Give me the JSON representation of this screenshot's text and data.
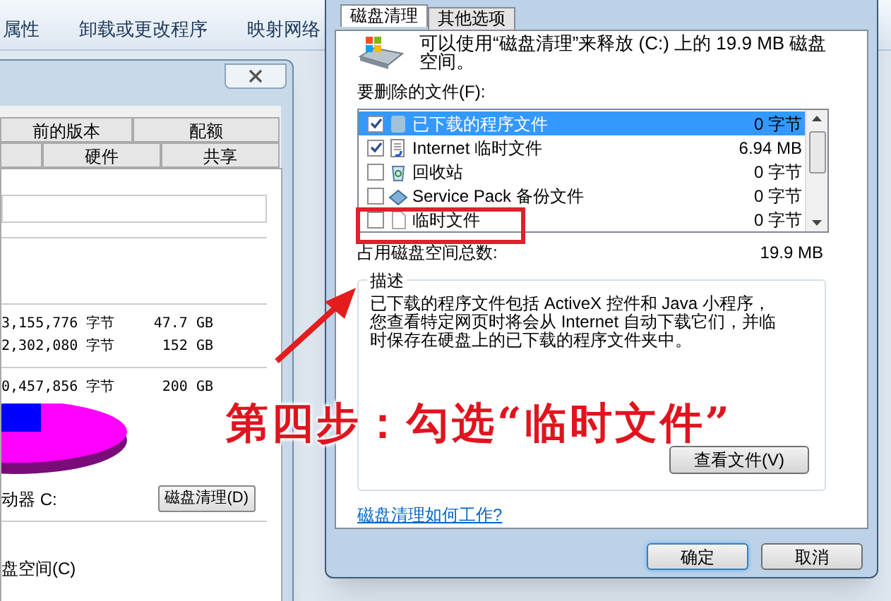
{
  "explorer_toolbar": {
    "items": [
      "属性",
      "卸载或更改程序",
      "映射网络"
    ]
  },
  "properties_dialog": {
    "tabs_row1": [
      "前的版本",
      "配额"
    ],
    "tabs_row2": [
      "硬件",
      "共享"
    ],
    "rows": [
      {
        "bytes": "3,155,776 字节",
        "size": "47.7 GB"
      },
      {
        "bytes": "2,302,080 字节",
        "size": "152 GB"
      },
      {
        "bytes": "0,457,856 字节",
        "size": "200 GB"
      }
    ],
    "drive_label": "动器 C:",
    "cleanup_button": "磁盘清理(D)",
    "compress_label": "盘空间(C)"
  },
  "cleanup_dialog": {
    "tabs": [
      {
        "label": "磁盘清理",
        "selected": true
      },
      {
        "label": "其他选项",
        "selected": false
      }
    ],
    "intro": "可以使用“磁盘清理”来释放 (C:) 上的 19.9 MB 磁盘空间。",
    "files_label": "要删除的文件(F):",
    "files": [
      {
        "name": "已下载的程序文件",
        "size": "0 字节",
        "checked": true,
        "selected": true
      },
      {
        "name": "Internet 临时文件",
        "size": "6.94 MB",
        "checked": true,
        "selected": false
      },
      {
        "name": "回收站",
        "size": "0 字节",
        "checked": false,
        "selected": false
      },
      {
        "name": "Service Pack 备份文件",
        "size": "0 字节",
        "checked": false,
        "selected": false
      },
      {
        "name": "临时文件",
        "size": "0 字节",
        "checked": false,
        "selected": false
      }
    ],
    "total_label": "占用磁盘空间总数:",
    "total": "19.9 MB",
    "description": {
      "title": "描述",
      "text": "已下载的程序文件包括 ActiveX 控件和 Java 小程序，您查看特定网页时将会从 Internet 自动下载它们，并临时保存在硬盘上的已下载的程序文件夹中。"
    },
    "view_files_button": "查看文件(V)",
    "help_link": "磁盘清理如何工作?",
    "buttons": [
      "确定",
      "取消"
    ]
  },
  "annotation": {
    "text": "第四步：勾选“临时文件”"
  }
}
